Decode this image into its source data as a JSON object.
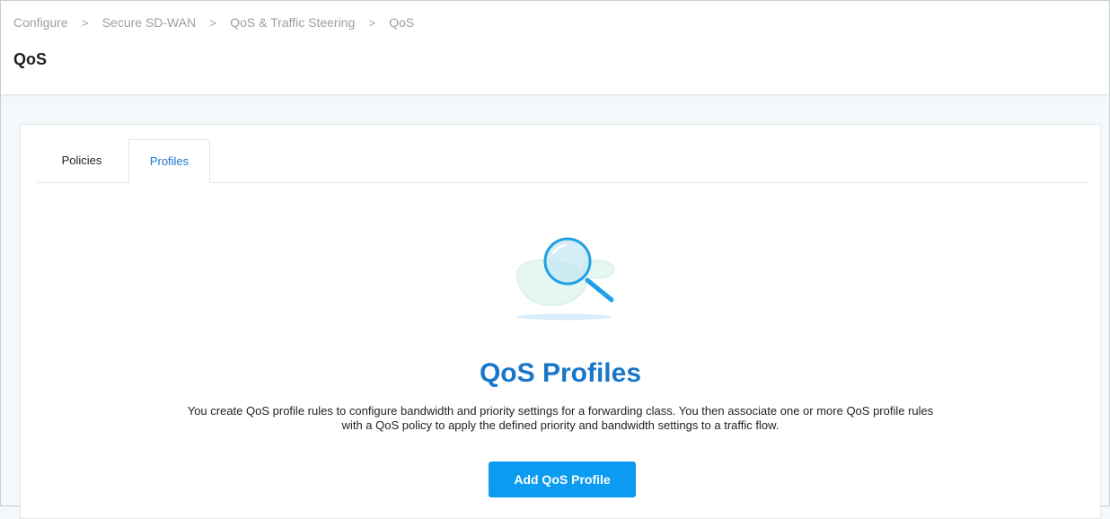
{
  "breadcrumb": {
    "items": [
      "Configure",
      "Secure SD-WAN",
      "QoS & Traffic Steering",
      "QoS"
    ],
    "separator": ">"
  },
  "page": {
    "title": "QoS"
  },
  "tabs": [
    {
      "label": "Policies",
      "active": false
    },
    {
      "label": "Profiles",
      "active": true
    }
  ],
  "empty_state": {
    "icon": "magnifier-icon",
    "title": "QoS Profiles",
    "description": "You create QoS profile rules to configure bandwidth and priority settings for a forwarding class. You then associate one or more QoS profile rules with a QoS policy to apply the defined priority and bandwidth settings to a traffic flow.",
    "button_label": "Add QoS Profile"
  },
  "colors": {
    "accent": "#1877c9",
    "button": "#0b9cf1",
    "active_tab": "#1a76d2",
    "background": "#f3f8fb"
  }
}
